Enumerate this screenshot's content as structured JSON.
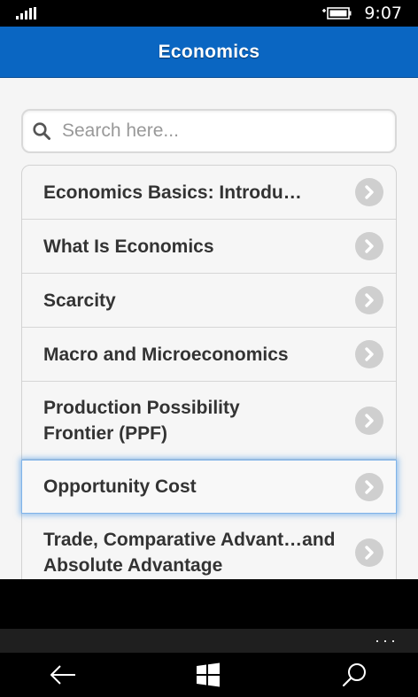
{
  "status": {
    "time": "9:07"
  },
  "header": {
    "title": "Economics"
  },
  "search": {
    "placeholder": "Search here..."
  },
  "topics": [
    {
      "label": "Economics Basics: Introdu…"
    },
    {
      "label": "What Is Economics"
    },
    {
      "label": "Scarcity"
    },
    {
      "label": "Macro and Microeconomics"
    },
    {
      "label": "Production Possibility Frontier (PPF)"
    },
    {
      "label": "Opportunity Cost"
    },
    {
      "label": "Trade, Comparative Advant…and Absolute Advantage"
    }
  ],
  "app_bar": {
    "more": "···"
  },
  "colors": {
    "accent": "#0a66c2",
    "list_bg": "#f6f6f6",
    "chevron": "#cfcfcf",
    "focus": "#7fb3e8"
  },
  "icons": [
    "signal-icon",
    "battery-icon",
    "search-icon",
    "chevron-right-icon",
    "back-icon",
    "windows-icon",
    "search-nav-icon"
  ]
}
